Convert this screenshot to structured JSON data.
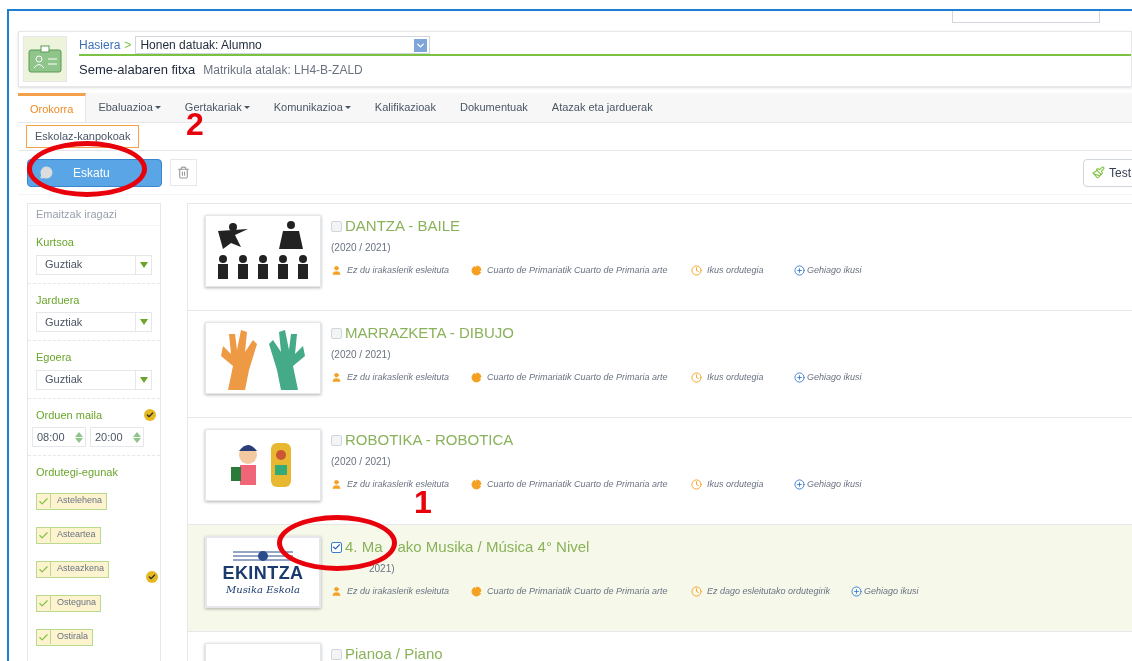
{
  "breadcrumb": {
    "home": "Hasiera",
    "separator": ">",
    "select_value": "Honen datuak: Alumno"
  },
  "header": {
    "title": "Seme-alabaren fitxa",
    "subtitle": "Matrikula atalak: LH4-B-ZALD"
  },
  "tabs": [
    {
      "label": "Orokorra",
      "selected": true,
      "dropdown": false
    },
    {
      "label": "Ebaluazioa",
      "selected": false,
      "dropdown": true
    },
    {
      "label": "Gertakariak",
      "selected": false,
      "dropdown": true
    },
    {
      "label": "Komunikazioa",
      "selected": false,
      "dropdown": true
    },
    {
      "label": "Kalifikazioak",
      "selected": false,
      "dropdown": false
    },
    {
      "label": "Dokumentuak",
      "selected": false,
      "dropdown": false
    },
    {
      "label": "Atazak eta jarduerak",
      "selected": false,
      "dropdown": false
    }
  ],
  "subtabs": [
    {
      "label": "Eskolaz-kanpokoak",
      "selected": true
    }
  ],
  "toolbar": {
    "request_button": "Eskatu",
    "right_button": "Test"
  },
  "filters": {
    "search_placeholder": "Emaitzak iragazi",
    "selects": [
      {
        "label": "Kurtsoa",
        "value": "Guztiak"
      },
      {
        "label": "Jarduera",
        "value": "Guztiak"
      },
      {
        "label": "Egoera",
        "value": "Guztiak"
      }
    ],
    "hours": {
      "label": "Orduen maila",
      "from": "08:00",
      "to": "20:00"
    },
    "days_label": "Ordutegi-egunak",
    "days": [
      {
        "label": "Astelehena",
        "checked": true
      },
      {
        "label": "Asteartea",
        "checked": true
      },
      {
        "label": "Asteazkena",
        "checked": true
      },
      {
        "label": "Osteguna",
        "checked": true
      },
      {
        "label": "Ostirala",
        "checked": true
      }
    ]
  },
  "activities": [
    {
      "title": [
        "DANTZA - BAILE"
      ],
      "kind": "dance",
      "year": "(2020 / 2021)",
      "checked": false,
      "selected": false,
      "teacher": "Ez du irakaslerik esleituta",
      "level": "Cuarto de Primariatik Cuarto de Primaria arte",
      "schedule": "Ikus ordutegia",
      "more": "Gehiago ikusi"
    },
    {
      "title": [
        "MARRAZKETA - DIBUJO"
      ],
      "kind": "hands",
      "year": "(2020 / 2021)",
      "checked": false,
      "selected": false,
      "teacher": "Ez du irakaslerik esleituta",
      "level": "Cuarto de Primariatik Cuarto de Primaria arte",
      "schedule": "Ikus ordutegia",
      "more": "Gehiago ikusi"
    },
    {
      "title": [
        "ROBOTIKA - ROBOTICA"
      ],
      "kind": "robot",
      "year": "(2020 / 2021)",
      "checked": false,
      "selected": false,
      "teacher": "Ez du irakaslerik esleituta",
      "level": "Cuarto de Primariatik Cuarto de Primaria arte",
      "schedule": "Ikus ordutegia",
      "more": "Gehiago ikusi"
    },
    {
      "title": [
        "4. Ma",
        "ako Musika / Música 4° Nivel"
      ],
      "kind": "logo",
      "logo_text": "EKINTZA",
      "logo_sub": "Musika Eskola",
      "year": "2021)",
      "checked": true,
      "selected": true,
      "teacher": "Ez du irakaslerik esleituta",
      "level": "Cuarto de Primariatik Cuarto de Primaria arte",
      "schedule": "Ez dago esleitutako ordutegirik",
      "more": "Gehiago ikusi"
    },
    {
      "title": [
        "Pianoa / Piano"
      ],
      "kind": "photo",
      "checked": false,
      "selected": false
    }
  ],
  "annotations": [
    {
      "label": "1"
    },
    {
      "label": "2"
    }
  ]
}
